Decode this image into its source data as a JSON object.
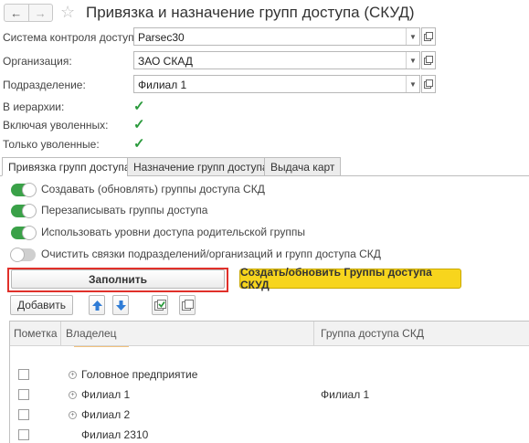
{
  "nav": {
    "back_icon": "arrow-left-icon",
    "forward_icon": "arrow-right-icon",
    "favorite_icon": "star-icon"
  },
  "window": {
    "title": "Привязка и назначение групп доступа (СКУД)"
  },
  "form": {
    "access_system": {
      "label": "Система контроля доступа:",
      "value": "Parsec30"
    },
    "organization": {
      "label": "Организация:",
      "value": "ЗАО СКАД"
    },
    "department": {
      "label": "Подразделение:",
      "value": "Филиал 1"
    },
    "in_hierarchy": {
      "label": "В иерархии:",
      "checked": true
    },
    "including_dismissed": {
      "label": "Включая уволенных:",
      "checked": true
    },
    "only_dismissed": {
      "label": "Только уволенные:",
      "checked": true
    }
  },
  "tabs": [
    {
      "label": "Привязка групп доступа",
      "active": true
    },
    {
      "label": "Назначение групп доступа",
      "active": false
    },
    {
      "label": "Выдача карт",
      "active": false
    }
  ],
  "options": [
    {
      "label": "Создавать (обновлять) группы доступа СКД",
      "on": true
    },
    {
      "label": "Перезаписывать группы доступа",
      "on": true
    },
    {
      "label": "Использовать уровни доступа родительской группы",
      "on": true
    },
    {
      "label": "Очистить связки подразделений/организаций и групп доступа СКД",
      "on": false
    }
  ],
  "buttons": {
    "fill": "Заполнить",
    "create_update": "Создать/обновить Группы доступа СКУД",
    "add": "Добавить"
  },
  "colors": {
    "accent_green": "#3aa148",
    "highlight_red": "#e0302a",
    "button_yellow": "#f7d51d",
    "arrow_blue": "#2f7cd6"
  },
  "table": {
    "columns": [
      "Пометка",
      "Владелец",
      "Группа доступа СКД"
    ],
    "rows": [
      {
        "owner": "Головное предприятие",
        "group": "",
        "expandable": true
      },
      {
        "owner": "Филиал 1",
        "group": "Филиал 1",
        "expandable": true
      },
      {
        "owner": "Филиал 2",
        "group": "",
        "expandable": true
      },
      {
        "owner": "Филиал 2310",
        "group": "",
        "expandable": false
      }
    ]
  }
}
